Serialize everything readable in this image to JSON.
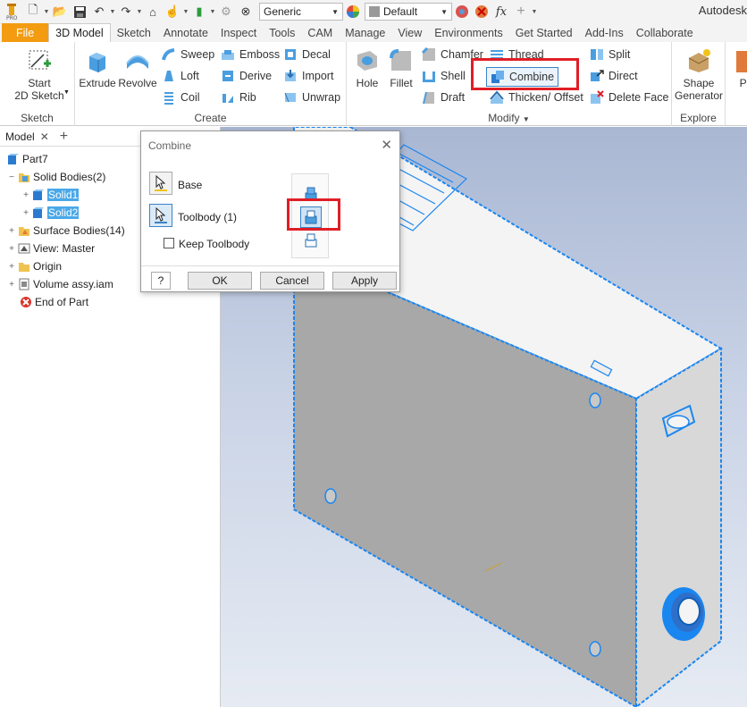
{
  "qat": {
    "material_value": "Generic",
    "appearance_value": "Default",
    "app_title": "Autodesk"
  },
  "tabs": [
    "File",
    "3D Model",
    "Sketch",
    "Annotate",
    "Inspect",
    "Tools",
    "CAM",
    "Manage",
    "View",
    "Environments",
    "Get Started",
    "Add-Ins",
    "Collaborate"
  ],
  "ribbon": {
    "sketch": {
      "title": "Sketch",
      "start_line1": "Start",
      "start_line2": "2D Sketch"
    },
    "create": {
      "title": "Create",
      "extrude": "Extrude",
      "revolve": "Revolve",
      "sweep": "Sweep",
      "loft": "Loft",
      "coil": "Coil",
      "emboss": "Emboss",
      "derive": "Derive",
      "rib": "Rib",
      "decal": "Decal",
      "import": "Import",
      "unwrap": "Unwrap"
    },
    "modify": {
      "title": "Modify",
      "hole": "Hole",
      "fillet": "Fillet",
      "chamfer": "Chamfer",
      "shell": "Shell",
      "draft": "Draft",
      "thread": "Thread",
      "combine": "Combine",
      "thicken": "Thicken/ Offset",
      "split": "Split",
      "direct": "Direct",
      "delete_face": "Delete Face"
    },
    "explore": {
      "title": "Explore",
      "shape_gen_line1": "Shape",
      "shape_gen_line2": "Generator"
    },
    "partial": "Pl"
  },
  "browser": {
    "tab_label": "Model",
    "add_label": "+",
    "tree": {
      "part": "Part7",
      "solid_bodies": "Solid Bodies(2)",
      "solid1": "Solid1",
      "solid2": "Solid2",
      "surface_bodies": "Surface Bodies(14)",
      "view": "View: Master",
      "origin": "Origin",
      "volume": "Volume assy.iam",
      "end": "End of Part"
    }
  },
  "dialog": {
    "title": "Combine",
    "base_label": "Base",
    "toolbody_label": "Toolbody (1)",
    "keep_toolbody_label": "Keep Toolbody",
    "help": "?",
    "ok": "OK",
    "cancel": "Cancel",
    "apply": "Apply"
  },
  "colors": {
    "file_tab": "#f39c12",
    "highlight": "#e01e26",
    "selection": "#4aa8e8",
    "edge_blue": "#1a86f0"
  }
}
